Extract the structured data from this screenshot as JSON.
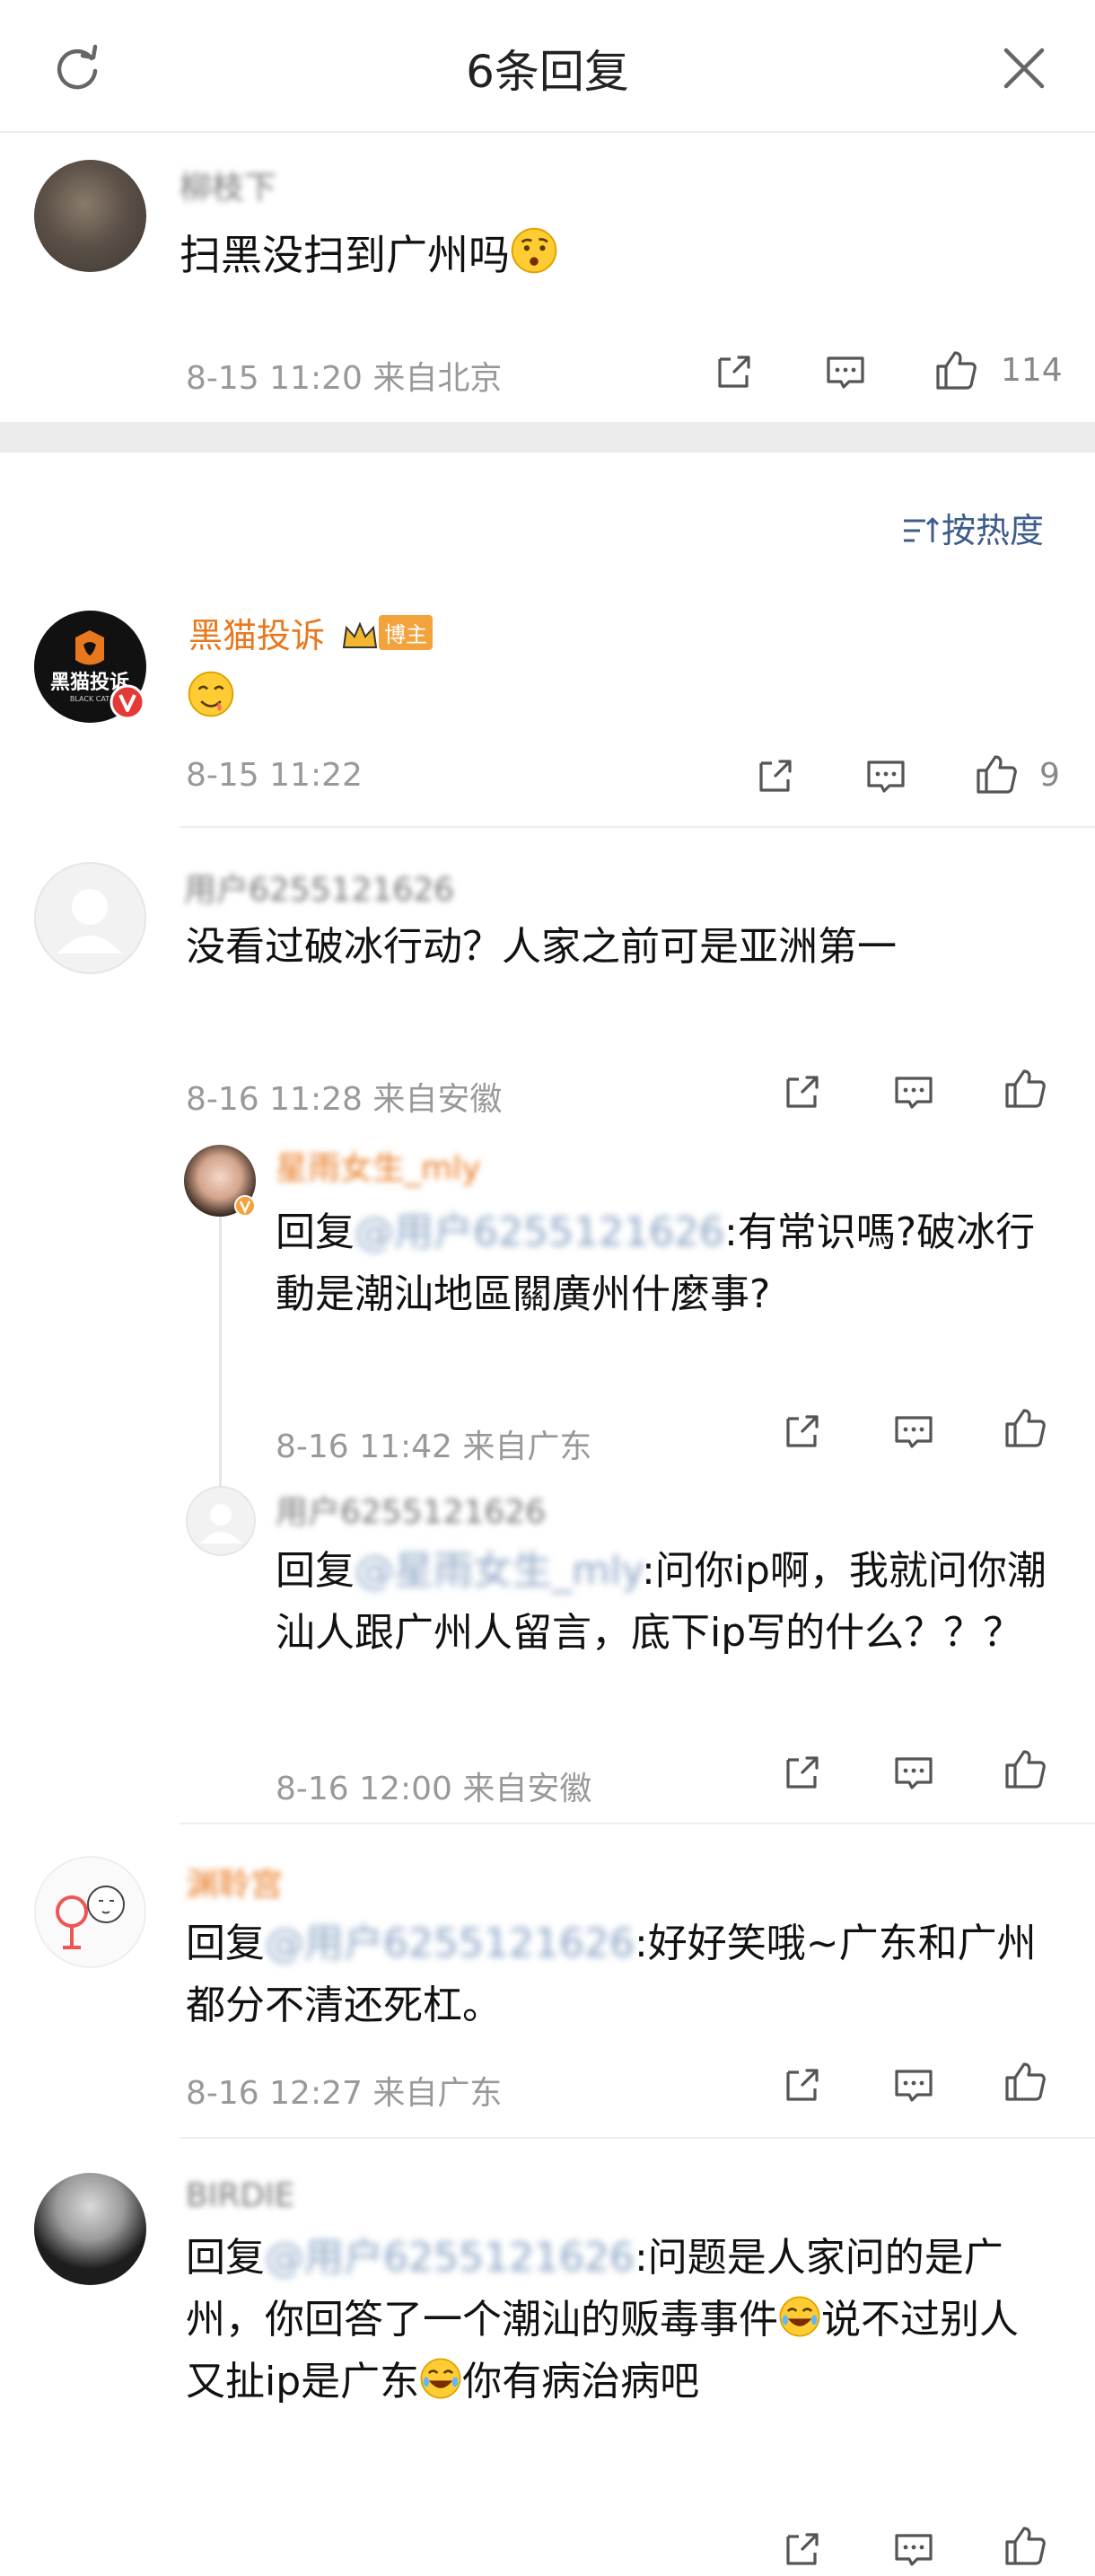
{
  "header": {
    "title": "6条回复"
  },
  "top_comment": {
    "username": "柳枝下",
    "text": "扫黑没扫到广州吗",
    "time": "8-15 11:20",
    "location": "来自北京",
    "likes": "114"
  },
  "sort": {
    "label": "按热度"
  },
  "replies": [
    {
      "username": "黑猫投诉",
      "badge": "博主",
      "avatar_text": "黑猫投诉",
      "time": "8-15 11:22",
      "location": "",
      "likes": "9"
    },
    {
      "username": "用户6255121626",
      "text": "没看过破冰行动？人家之前可是亚洲第一",
      "time": "8-16 11:28",
      "location": "来自安徽",
      "likes": ""
    },
    {
      "username": "星雨女生_mly",
      "reply_prefix": "回复",
      "mention": "@用户6255121626",
      "text": ":有常识嗎?破冰行動是潮汕地區關廣州什麼事?",
      "time": "8-16 11:42",
      "location": "来自广东",
      "likes": ""
    },
    {
      "username": "用户6255121626",
      "reply_prefix": "回复",
      "mention": "@星雨女生_mly",
      "text": ":问你ip啊，我就问你潮汕人跟广州人留言，底下ip写的什么？？？",
      "time": "8-16 12:00",
      "location": "来自安徽",
      "likes": ""
    },
    {
      "username": "渊聆宫",
      "reply_prefix": "回复",
      "mention": "@用户6255121626",
      "text": ":好好笑哦~广东和广州都分不清还死杠。",
      "time": "8-16 12:27",
      "location": "来自广东",
      "likes": ""
    },
    {
      "username": "BIRDIE",
      "reply_prefix": "回复",
      "mention": "@用户6255121626",
      "text_parts": [
        ":问题是人家问的是广州，你回答了一个潮汕的贩毒事件",
        "说不过别人又扯ip是广东",
        "你有病治病吧"
      ],
      "time": "",
      "location": "",
      "likes": ""
    }
  ],
  "colors": {
    "link": "#3d72b5",
    "vip_name": "#e8781e",
    "meta": "#999999",
    "divider": "#ebebeb"
  },
  "icons": [
    "refresh-icon",
    "close-icon",
    "share-icon",
    "comment-icon",
    "like-icon",
    "sort-icon",
    "emoji-thinking",
    "emoji-yum",
    "emoji-laughing-crying"
  ]
}
